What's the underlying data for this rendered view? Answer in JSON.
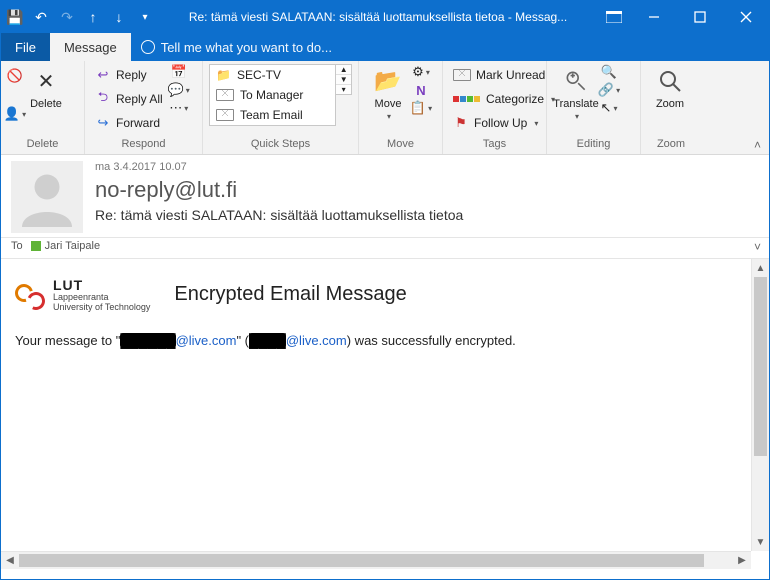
{
  "window": {
    "title": "Re: tämä viesti SALATAAN:  sisältää luottamuksellista tietoa - Messag..."
  },
  "tabs": {
    "file": "File",
    "message": "Message",
    "tellme": "Tell me what you want to do..."
  },
  "ribbon": {
    "delete": {
      "label": "Delete",
      "group": "Delete"
    },
    "respond": {
      "reply": "Reply",
      "reply_all": "Reply All",
      "forward": "Forward",
      "group": "Respond"
    },
    "quick_steps": {
      "items": [
        "SEC-TV",
        "To Manager",
        "Team Email"
      ],
      "group": "Quick Steps"
    },
    "move": {
      "label": "Move",
      "group": "Move"
    },
    "tags": {
      "mark_unread": "Mark Unread",
      "categorize": "Categorize",
      "follow_up": "Follow Up",
      "group": "Tags"
    },
    "editing": {
      "translate": "Translate",
      "group": "Editing"
    },
    "zoom": {
      "label": "Zoom",
      "group": "Zoom"
    }
  },
  "message": {
    "date": "ma 3.4.2017 10.07",
    "from": "no-reply@lut.fi",
    "subject": "Re: tämä viesti SALATAAN:  sisältää luottamuksellista tietoa",
    "to_label": "To",
    "to_name": "Jari Taipale"
  },
  "body": {
    "logo": {
      "name": "LUT",
      "sub1": "Lappeenranta",
      "sub2": "University of Technology"
    },
    "title": "Encrypted Email Message",
    "line_prefix": "Your message to \"",
    "redacted1": "██████",
    "link1": "@live.com",
    "mid1": "\" (",
    "redacted2": "████",
    "link2": "@live.com",
    "suffix": ") was successfully encrypted."
  }
}
